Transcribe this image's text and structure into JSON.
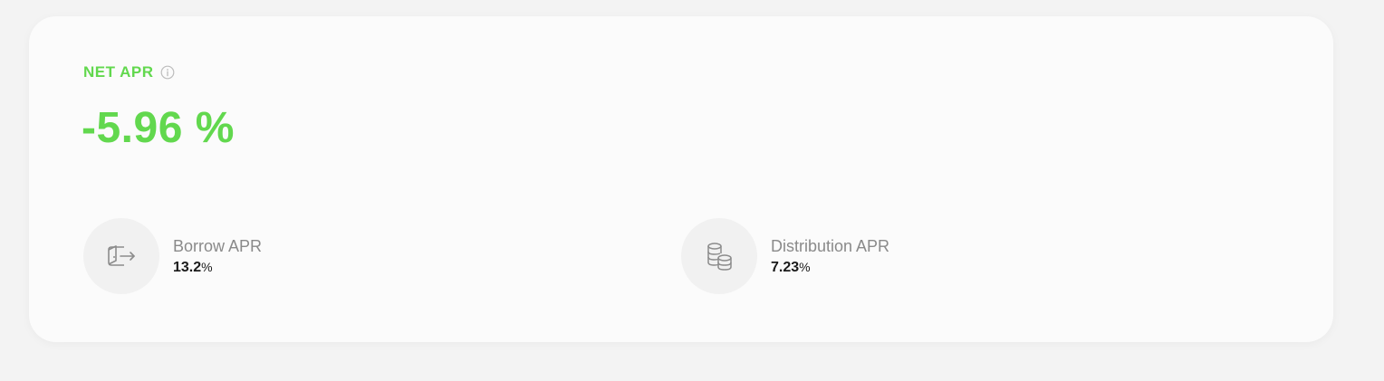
{
  "net_apr": {
    "label": "NET APR",
    "value": "-5.96 %",
    "info_icon": "info-icon"
  },
  "borrow": {
    "label": "Borrow APR",
    "value": "13.2",
    "unit": "%",
    "icon": "borrow-exit-icon"
  },
  "distribution": {
    "label": "Distribution APR",
    "value": "7.23",
    "unit": "%",
    "icon": "coins-stack-icon"
  },
  "colors": {
    "accent": "#62d84e",
    "muted_text": "#8a8a8a",
    "value_text": "#1a1a1a",
    "icon_bg": "#f1f1f1",
    "card_bg": "#fbfbfb",
    "page_bg": "#f3f3f3"
  }
}
